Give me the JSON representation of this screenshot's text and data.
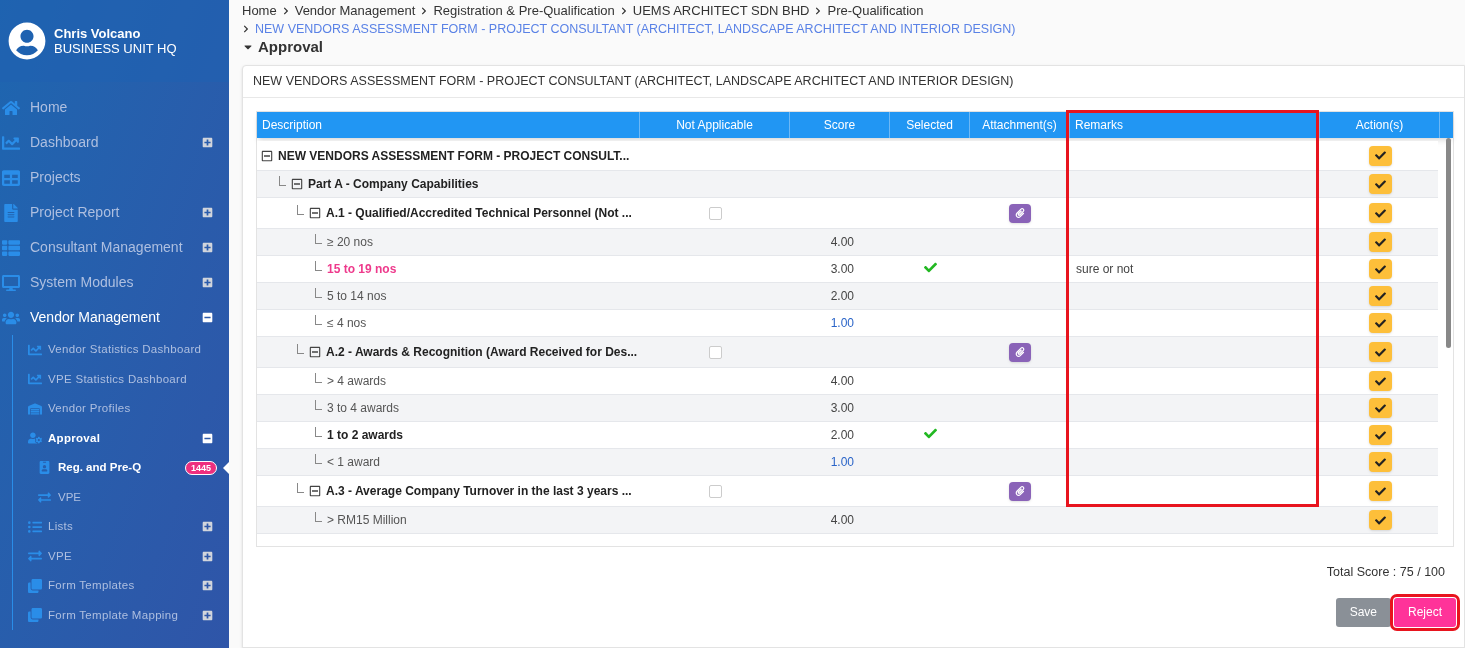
{
  "user": {
    "name": "Chris Volcano",
    "unit": "BUSINESS UNIT HQ"
  },
  "sidebar": {
    "items": [
      {
        "label": "Home",
        "selected": false
      },
      {
        "label": "Dashboard",
        "selected": false,
        "expanded": false
      },
      {
        "label": "Projects",
        "selected": false
      },
      {
        "label": "Project Report",
        "selected": false,
        "expanded": false
      },
      {
        "label": "Consultant Management",
        "selected": false,
        "expanded": false
      },
      {
        "label": "System Modules",
        "selected": false,
        "expanded": false
      },
      {
        "label": "Vendor Management",
        "selected": true,
        "expanded": true,
        "children": [
          {
            "label": "Vendor Statistics Dashboard",
            "selected": false
          },
          {
            "label": "VPE Statistics Dashboard",
            "selected": false
          },
          {
            "label": "Vendor Profiles",
            "selected": false
          },
          {
            "label": "Approval",
            "selected": true,
            "expanded": true,
            "children": [
              {
                "label": "Reg. and Pre-Q",
                "selected": true,
                "badge": "1445"
              },
              {
                "label": "VPE",
                "selected": false
              }
            ]
          },
          {
            "label": "Lists",
            "selected": false,
            "expanded": false
          },
          {
            "label": "VPE",
            "selected": false,
            "expanded": false
          },
          {
            "label": "Form Templates",
            "selected": false,
            "expanded": false
          },
          {
            "label": "Form Template Mapping",
            "selected": false,
            "expanded": false
          }
        ]
      }
    ]
  },
  "breadcrumb": {
    "items": [
      "Home",
      "Vendor Management",
      "Registration & Pre-Qualification",
      "UEMS ARCHITECT SDN BHD",
      "Pre-Qualification"
    ],
    "current": "NEW VENDORS ASSESSMENT FORM - PROJECT CONSULTANT (ARCHITECT, LANDSCAPE ARCHITECT AND INTERIOR DESIGN)"
  },
  "section_title": "Approval",
  "card": {
    "title": "NEW VENDORS ASSESSMENT FORM - PROJECT CONSULTANT (ARCHITECT, LANDSCAPE ARCHITECT AND INTERIOR DESIGN)"
  },
  "table": {
    "columns": [
      {
        "label": "Description",
        "highlight": false
      },
      {
        "label": "Not Applicable",
        "highlight": false
      },
      {
        "label": "Score",
        "highlight": false
      },
      {
        "label": "Selected",
        "highlight": false
      },
      {
        "label": "Attachment(s)",
        "highlight": false
      },
      {
        "label": "Remarks",
        "highlight": true
      },
      {
        "label": "Action(s)",
        "highlight": false
      }
    ],
    "rows": [
      {
        "kind": "form",
        "description": "NEW VENDORS ASSESSMENT FORM - PROJECT CONSULT...",
        "expanded": true,
        "children": [
          {
            "kind": "part",
            "description": "Part A - Company Capabilities",
            "expanded": true,
            "children": [
              {
                "kind": "criterion",
                "description": "A.1 - Qualified/Accredited Technical Personnel (Not ...",
                "expanded": true,
                "not_applicable": false,
                "children": [
                  {
                    "kind": "option",
                    "description": "≥ 20 nos",
                    "score": "4.00",
                    "selected": false,
                    "current": false,
                    "score_link": false
                  },
                  {
                    "kind": "option",
                    "description": "15 to 19 nos",
                    "score": "3.00",
                    "selected": true,
                    "current": true,
                    "score_link": false,
                    "remarks": "sure or not"
                  },
                  {
                    "kind": "option",
                    "description": "5 to 14 nos",
                    "score": "2.00",
                    "selected": false,
                    "current": false,
                    "score_link": false
                  },
                  {
                    "kind": "option",
                    "description": "≤ 4 nos",
                    "score": "1.00",
                    "selected": false,
                    "current": false,
                    "score_link": true
                  }
                ]
              },
              {
                "kind": "criterion",
                "description": "A.2 - Awards & Recognition (Award Received for Des...",
                "expanded": true,
                "not_applicable": false,
                "children": [
                  {
                    "kind": "option",
                    "description": "> 4 awards",
                    "score": "4.00",
                    "selected": false,
                    "current": false,
                    "score_link": false
                  },
                  {
                    "kind": "option",
                    "description": "3 to 4 awards",
                    "score": "3.00",
                    "selected": false,
                    "current": false,
                    "score_link": false
                  },
                  {
                    "kind": "option",
                    "description": "1 to 2 awards",
                    "score": "2.00",
                    "selected": true,
                    "current": false,
                    "score_link": false
                  },
                  {
                    "kind": "option",
                    "description": "< 1 award",
                    "score": "1.00",
                    "selected": false,
                    "current": false,
                    "score_link": true
                  }
                ]
              },
              {
                "kind": "criterion",
                "description": "A.3 - Average Company Turnover in the last 3 years ...",
                "expanded": true,
                "not_applicable": false,
                "children": [
                  {
                    "kind": "option",
                    "description": "> RM15 Million",
                    "score": "4.00",
                    "selected": false,
                    "current": false,
                    "score_link": false
                  }
                ]
              }
            ]
          }
        ]
      }
    ]
  },
  "total_score": "Total Score : 75 / 100",
  "buttons": [
    {
      "kind": "save",
      "label": "Save",
      "highlight": false
    },
    {
      "kind": "reject",
      "label": "Reject",
      "highlight": true
    }
  ]
}
